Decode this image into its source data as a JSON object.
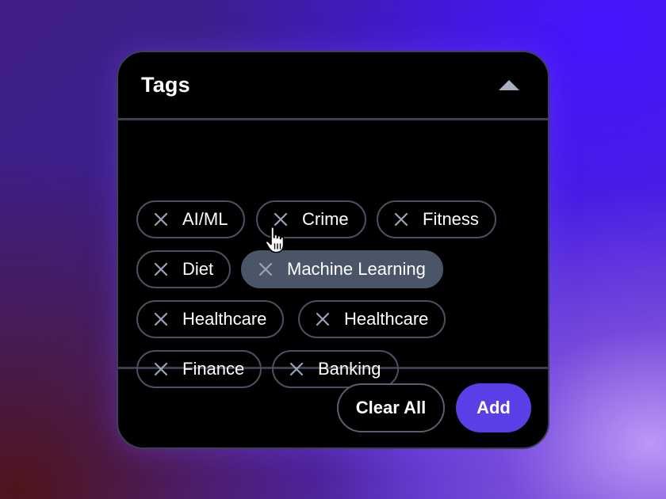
{
  "panel": {
    "title": "Tags",
    "collapse_icon": "chevron-up-icon"
  },
  "tags": [
    {
      "label": "AI/ML"
    },
    {
      "label": "Crime"
    },
    {
      "label": "Fitness"
    },
    {
      "label": "Diet"
    },
    {
      "label": "Machine Learning",
      "hovered": true
    },
    {
      "label": "Healthcare"
    },
    {
      "label": "Healthcare"
    },
    {
      "label": "Finance"
    },
    {
      "label": "Banking"
    }
  ],
  "actions": {
    "clear_label": "Clear All",
    "add_label": "Add"
  },
  "colors": {
    "accent": "#5840e6",
    "panel_bg": "#000000",
    "tag_border": "#4b4f62",
    "tag_hover_bg": "#4a5568",
    "remove_icon": "#9aa3b8"
  }
}
